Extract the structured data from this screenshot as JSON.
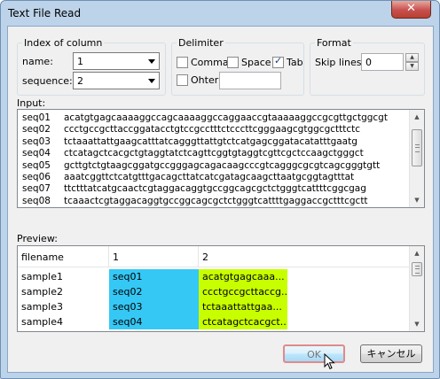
{
  "window": {
    "title": "Text File Read",
    "close_glyph": "✕"
  },
  "index_group": {
    "title": "Index of column",
    "name_label": "name:",
    "name_value": "1",
    "sequence_label": "sequence:",
    "sequence_value": "2"
  },
  "delimiter_group": {
    "title": "Delimiter",
    "comma_label": "Comma",
    "space_label": "Space",
    "tab_label": "Tab",
    "other_label": "Ohter",
    "other_value": "",
    "comma_checked": false,
    "space_checked": false,
    "tab_checked": true,
    "other_checked": false
  },
  "format_group": {
    "title": "Format",
    "skip_label": "Skip lines:",
    "skip_value": "0"
  },
  "input": {
    "label": "Input:",
    "rows": [
      {
        "id": "seq01",
        "seq": "acatgtgagcaaaaggccagcaaaaggccaggaaccgtaaaaaggccgcgttgctggcgt"
      },
      {
        "id": "seq02",
        "seq": "ccctgccgcttaccggatacctgtccgcctttctcccttcgggaagcgtggcgctttctc"
      },
      {
        "id": "seq03",
        "seq": "tctaaattattgaagcatttatcagggttattgtctcatgagcggatacatatttgaatg"
      },
      {
        "id": "seq04",
        "seq": "ctcatagctcacgctgtaggtatctcagttcggtgtaggtcgttcgctccaagctgggct"
      },
      {
        "id": "seq05",
        "seq": "gcttgtctgtaagcggatgccgggagcagacaagcccgtcagggcgcgtcagcgggtgtt"
      },
      {
        "id": "seq06",
        "seq": "aaatcggttctcatgtttgacagcttatcatcgatagcaagcttaatgcggtagtttat"
      },
      {
        "id": "seq07",
        "seq": "ttctttatcatgcaactcgtaggacaggtgccggcagcgctctgggtcattttcggcgag"
      },
      {
        "id": "seq08",
        "seq": "tcaaactcgtaggacaggtgccggcagcgctctgggtcattttgaggaccgctttcgctt"
      }
    ]
  },
  "preview": {
    "label": "Preview:",
    "columns": [
      "filename",
      "1",
      "2"
    ],
    "rows": [
      {
        "filename": "sample1",
        "c1": "seq01",
        "c2": "acatgtgagcaaa..."
      },
      {
        "filename": "sample2",
        "c1": "seq02",
        "c2": "ccctgccgcttaccg..."
      },
      {
        "filename": "sample3",
        "c1": "seq03",
        "c2": "tctaaattattgaa..."
      },
      {
        "filename": "sample4",
        "c1": "seq04",
        "c2": "ctcatagctcacgct..."
      }
    ]
  },
  "colors": {
    "col1_highlight": "#35c8f5",
    "col2_highlight": "#c8ff00",
    "window_frame": "#bdd3ea"
  },
  "buttons": {
    "ok": "OK",
    "cancel": "キャンセル"
  },
  "icons": {
    "dropdown": "chevron-down-icon",
    "spin_up": "arrow-up-icon",
    "spin_down": "arrow-down-icon",
    "cursor": "mouse-pointer-icon"
  }
}
